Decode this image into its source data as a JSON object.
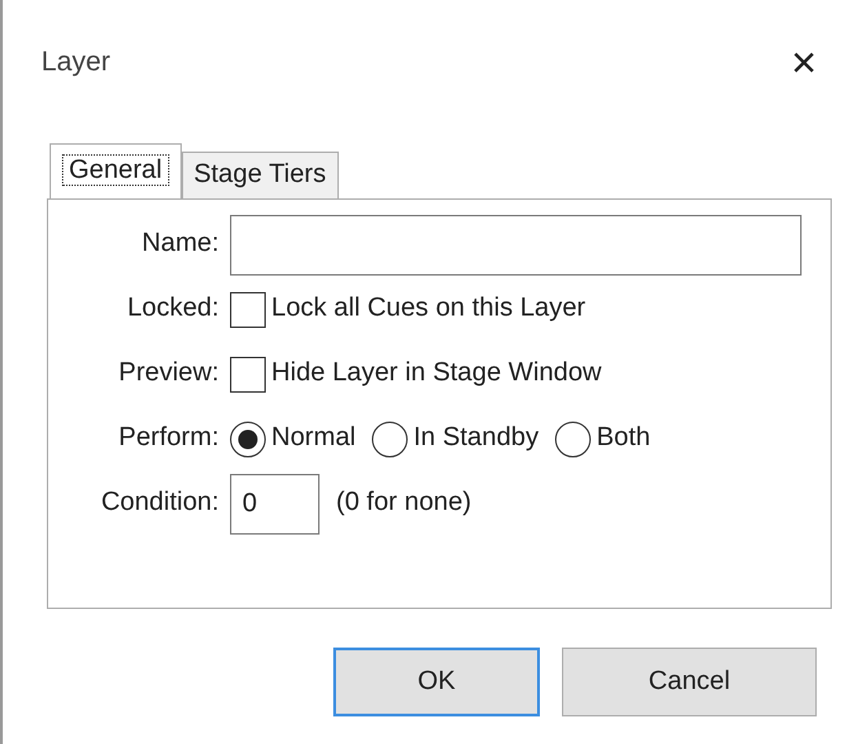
{
  "window": {
    "title": "Layer",
    "close": "×"
  },
  "tabs": [
    {
      "label": "General",
      "selected": true
    },
    {
      "label": "Stage Tiers",
      "selected": false
    }
  ],
  "fields": [
    {
      "kind": "text",
      "label": "Name:"
    },
    {
      "kind": "checkbox",
      "label": "Locked:",
      "text": "Lock all Cues on this Layer",
      "checked": false
    },
    {
      "kind": "checkbox",
      "label": "Preview:",
      "text": "Hide Layer in Stage Window",
      "checked": false
    },
    {
      "kind": "radio",
      "label": "Perform:",
      "options": [
        {
          "label": "Normal",
          "selected": true
        },
        {
          "label": "In Standby",
          "selected": false
        },
        {
          "label": "Both",
          "selected": false
        }
      ]
    },
    {
      "kind": "number",
      "label": "Condition:",
      "value": "0",
      "hint": "(0 for none)"
    }
  ],
  "buttons": [
    {
      "label": "OK",
      "default": true
    },
    {
      "label": "Cancel",
      "default": false
    }
  ]
}
